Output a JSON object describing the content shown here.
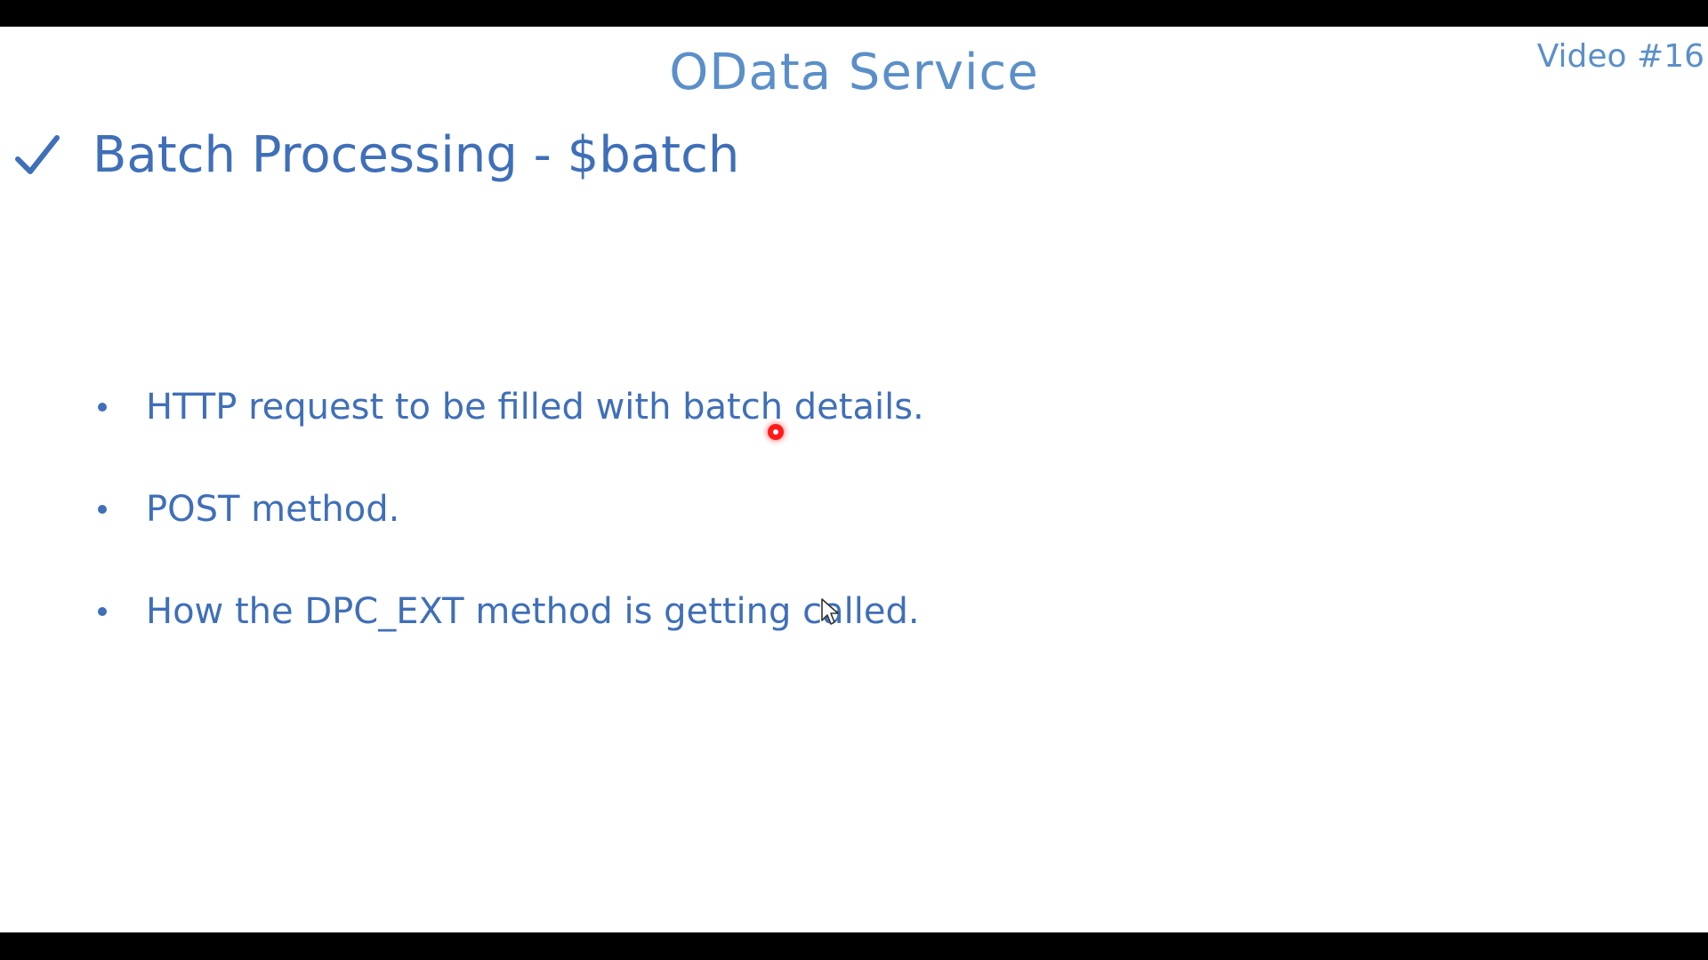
{
  "slide": {
    "title": "OData Service",
    "video_tag": "Video #16",
    "heading": {
      "icon": "checkmark-icon",
      "text": "Batch Processing - $batch"
    },
    "bullets": [
      "HTTP request to be filled with batch details.",
      "POST method.",
      "How the DPC_EXT method is getting called."
    ]
  },
  "overlay": {
    "laser_pointer_icon": "laser-pointer-dot",
    "cursor_icon": "mouse-pointer-icon"
  },
  "colors": {
    "title": "#5b8fc9",
    "text": "#3f6fb8",
    "laser": "#ff1a1a",
    "letterbox": "#000000"
  }
}
